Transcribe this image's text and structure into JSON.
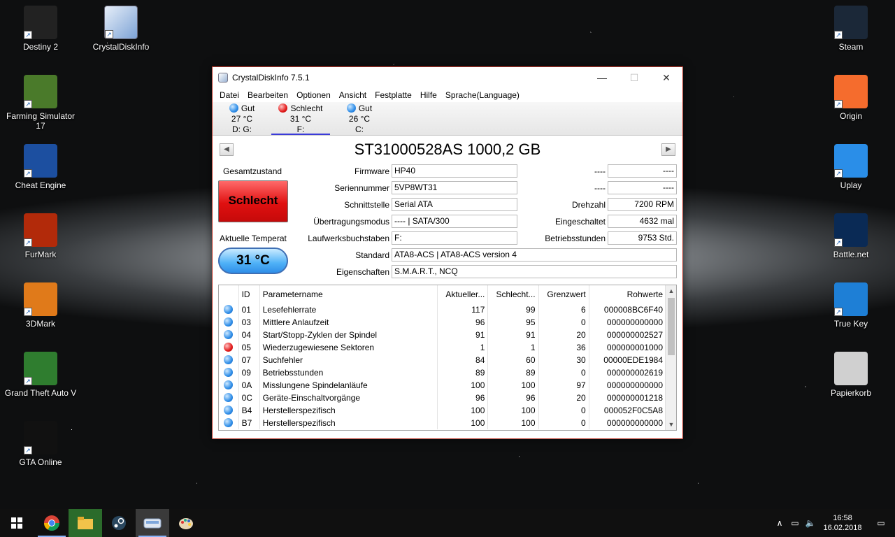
{
  "desktop": {
    "left_icons": [
      {
        "label": "Destiny 2",
        "icon": "destiny-icon",
        "color": "#222222"
      },
      {
        "label": "Farming Simulator 17",
        "icon": "farming-simulator-icon",
        "color": "#4a7a2a"
      },
      {
        "label": "Cheat Engine",
        "icon": "cheat-engine-icon",
        "color": "#1c4fa0"
      },
      {
        "label": "FurMark",
        "icon": "furmark-icon",
        "color": "#b22a0a"
      },
      {
        "label": "3DMark",
        "icon": "3dmark-icon",
        "color": "#e07a1a"
      },
      {
        "label": "Grand Theft Auto V",
        "icon": "gta-v-icon",
        "color": "#2f7d2f"
      },
      {
        "label": "GTA Online",
        "icon": "gta-online-icon",
        "color": "#111111"
      }
    ],
    "right_icons": [
      {
        "label": "Steam",
        "icon": "steam-icon",
        "color": "#1b2838"
      },
      {
        "label": "Origin",
        "icon": "origin-icon",
        "color": "#f56c2d"
      },
      {
        "label": "Uplay",
        "icon": "uplay-icon",
        "color": "#2a8ee8"
      },
      {
        "label": "Battle.net",
        "icon": "battlenet-icon",
        "color": "#0a2a55"
      },
      {
        "label": "True Key",
        "icon": "truekey-icon",
        "color": "#1e7fd6"
      },
      {
        "label": "Papierkorb",
        "icon": "recycle-bin-icon",
        "color": "#d0d0d0"
      }
    ],
    "top_icon": {
      "label": "CrystalDiskInfo",
      "icon": "crystaldiskinfo-icon"
    }
  },
  "window": {
    "title": "CrystalDiskInfo 7.5.1",
    "menu": [
      "Datei",
      "Bearbeiten",
      "Optionen",
      "Ansicht",
      "Festplatte",
      "Hilfe",
      "Sprache(Language)"
    ],
    "disks": [
      {
        "status": "Gut",
        "temp": "27 °C",
        "letters": "D: G:",
        "color": "blue"
      },
      {
        "status": "Schlecht",
        "temp": "31 °C",
        "letters": "F:",
        "color": "red"
      },
      {
        "status": "Gut",
        "temp": "26 °C",
        "letters": "C:",
        "color": "blue"
      }
    ],
    "model": "ST31000528AS 1000,2 GB",
    "labels": {
      "gesamtzustand": "Gesamtzustand",
      "temperatur": "Aktuelle Temperat",
      "firmware": "Firmware",
      "seriennummer": "Seriennummer",
      "schnittstelle": "Schnittstelle",
      "uebertragungsmodus": "Übertragungsmodus",
      "laufwerksbuchstaben": "Laufwerksbuchstaben",
      "standard": "Standard",
      "eigenschaften": "Eigenschaften",
      "dash1": "----",
      "dash2": "----",
      "drehzahl": "Drehzahl",
      "eingeschaltet": "Eingeschaltet",
      "betriebsstunden": "Betriebsstunden"
    },
    "values": {
      "health": "Schlecht",
      "temperature": "31 °C",
      "firmware": "HP40",
      "seriennummer": "5VP8WT31",
      "schnittstelle": "Serial ATA",
      "uebertragungsmodus": "---- | SATA/300",
      "laufwerksbuchstaben": "F:",
      "standard": "ATA8-ACS | ATA8-ACS version 4",
      "eigenschaften": "S.M.A.R.T., NCQ",
      "dash1": "----",
      "dash2": "----",
      "drehzahl": "7200 RPM",
      "eingeschaltet": "4632 mal",
      "betriebsstunden": "9753 Std."
    },
    "smart": {
      "headers": [
        "ID",
        "Parametername",
        "Aktueller...",
        "Schlecht...",
        "Grenzwert",
        "Rohwerte"
      ],
      "rows": [
        {
          "status": "blue",
          "id": "01",
          "name": "Lesefehlerrate",
          "cur": "117",
          "worst": "99",
          "thr": "6",
          "raw": "000008BC6F40"
        },
        {
          "status": "blue",
          "id": "03",
          "name": "Mittlere Anlaufzeit",
          "cur": "96",
          "worst": "95",
          "thr": "0",
          "raw": "000000000000"
        },
        {
          "status": "blue",
          "id": "04",
          "name": "Start/Stopp-Zyklen der Spindel",
          "cur": "91",
          "worst": "91",
          "thr": "20",
          "raw": "000000002527"
        },
        {
          "status": "red",
          "id": "05",
          "name": "Wiederzugewiesene Sektoren",
          "cur": "1",
          "worst": "1",
          "thr": "36",
          "raw": "000000001000"
        },
        {
          "status": "blue",
          "id": "07",
          "name": "Suchfehler",
          "cur": "84",
          "worst": "60",
          "thr": "30",
          "raw": "00000EDE1984"
        },
        {
          "status": "blue",
          "id": "09",
          "name": "Betriebsstunden",
          "cur": "89",
          "worst": "89",
          "thr": "0",
          "raw": "000000002619"
        },
        {
          "status": "blue",
          "id": "0A",
          "name": "Misslungene Spindelanläufe",
          "cur": "100",
          "worst": "100",
          "thr": "97",
          "raw": "000000000000"
        },
        {
          "status": "blue",
          "id": "0C",
          "name": "Geräte-Einschaltvorgänge",
          "cur": "96",
          "worst": "96",
          "thr": "20",
          "raw": "000000001218"
        },
        {
          "status": "blue",
          "id": "B4",
          "name": "Herstellerspezifisch",
          "cur": "100",
          "worst": "100",
          "thr": "0",
          "raw": "000052F0C5A8"
        },
        {
          "status": "blue",
          "id": "B7",
          "name": "Herstellerspezifisch",
          "cur": "100",
          "worst": "100",
          "thr": "0",
          "raw": "000000000000"
        }
      ]
    }
  },
  "taskbar": {
    "apps": [
      "chrome-icon",
      "file-explorer-icon",
      "steam-tb-icon",
      "crystaldiskinfo-tb-icon",
      "paint-icon"
    ],
    "time": "16:58",
    "date": "16.02.2018"
  }
}
